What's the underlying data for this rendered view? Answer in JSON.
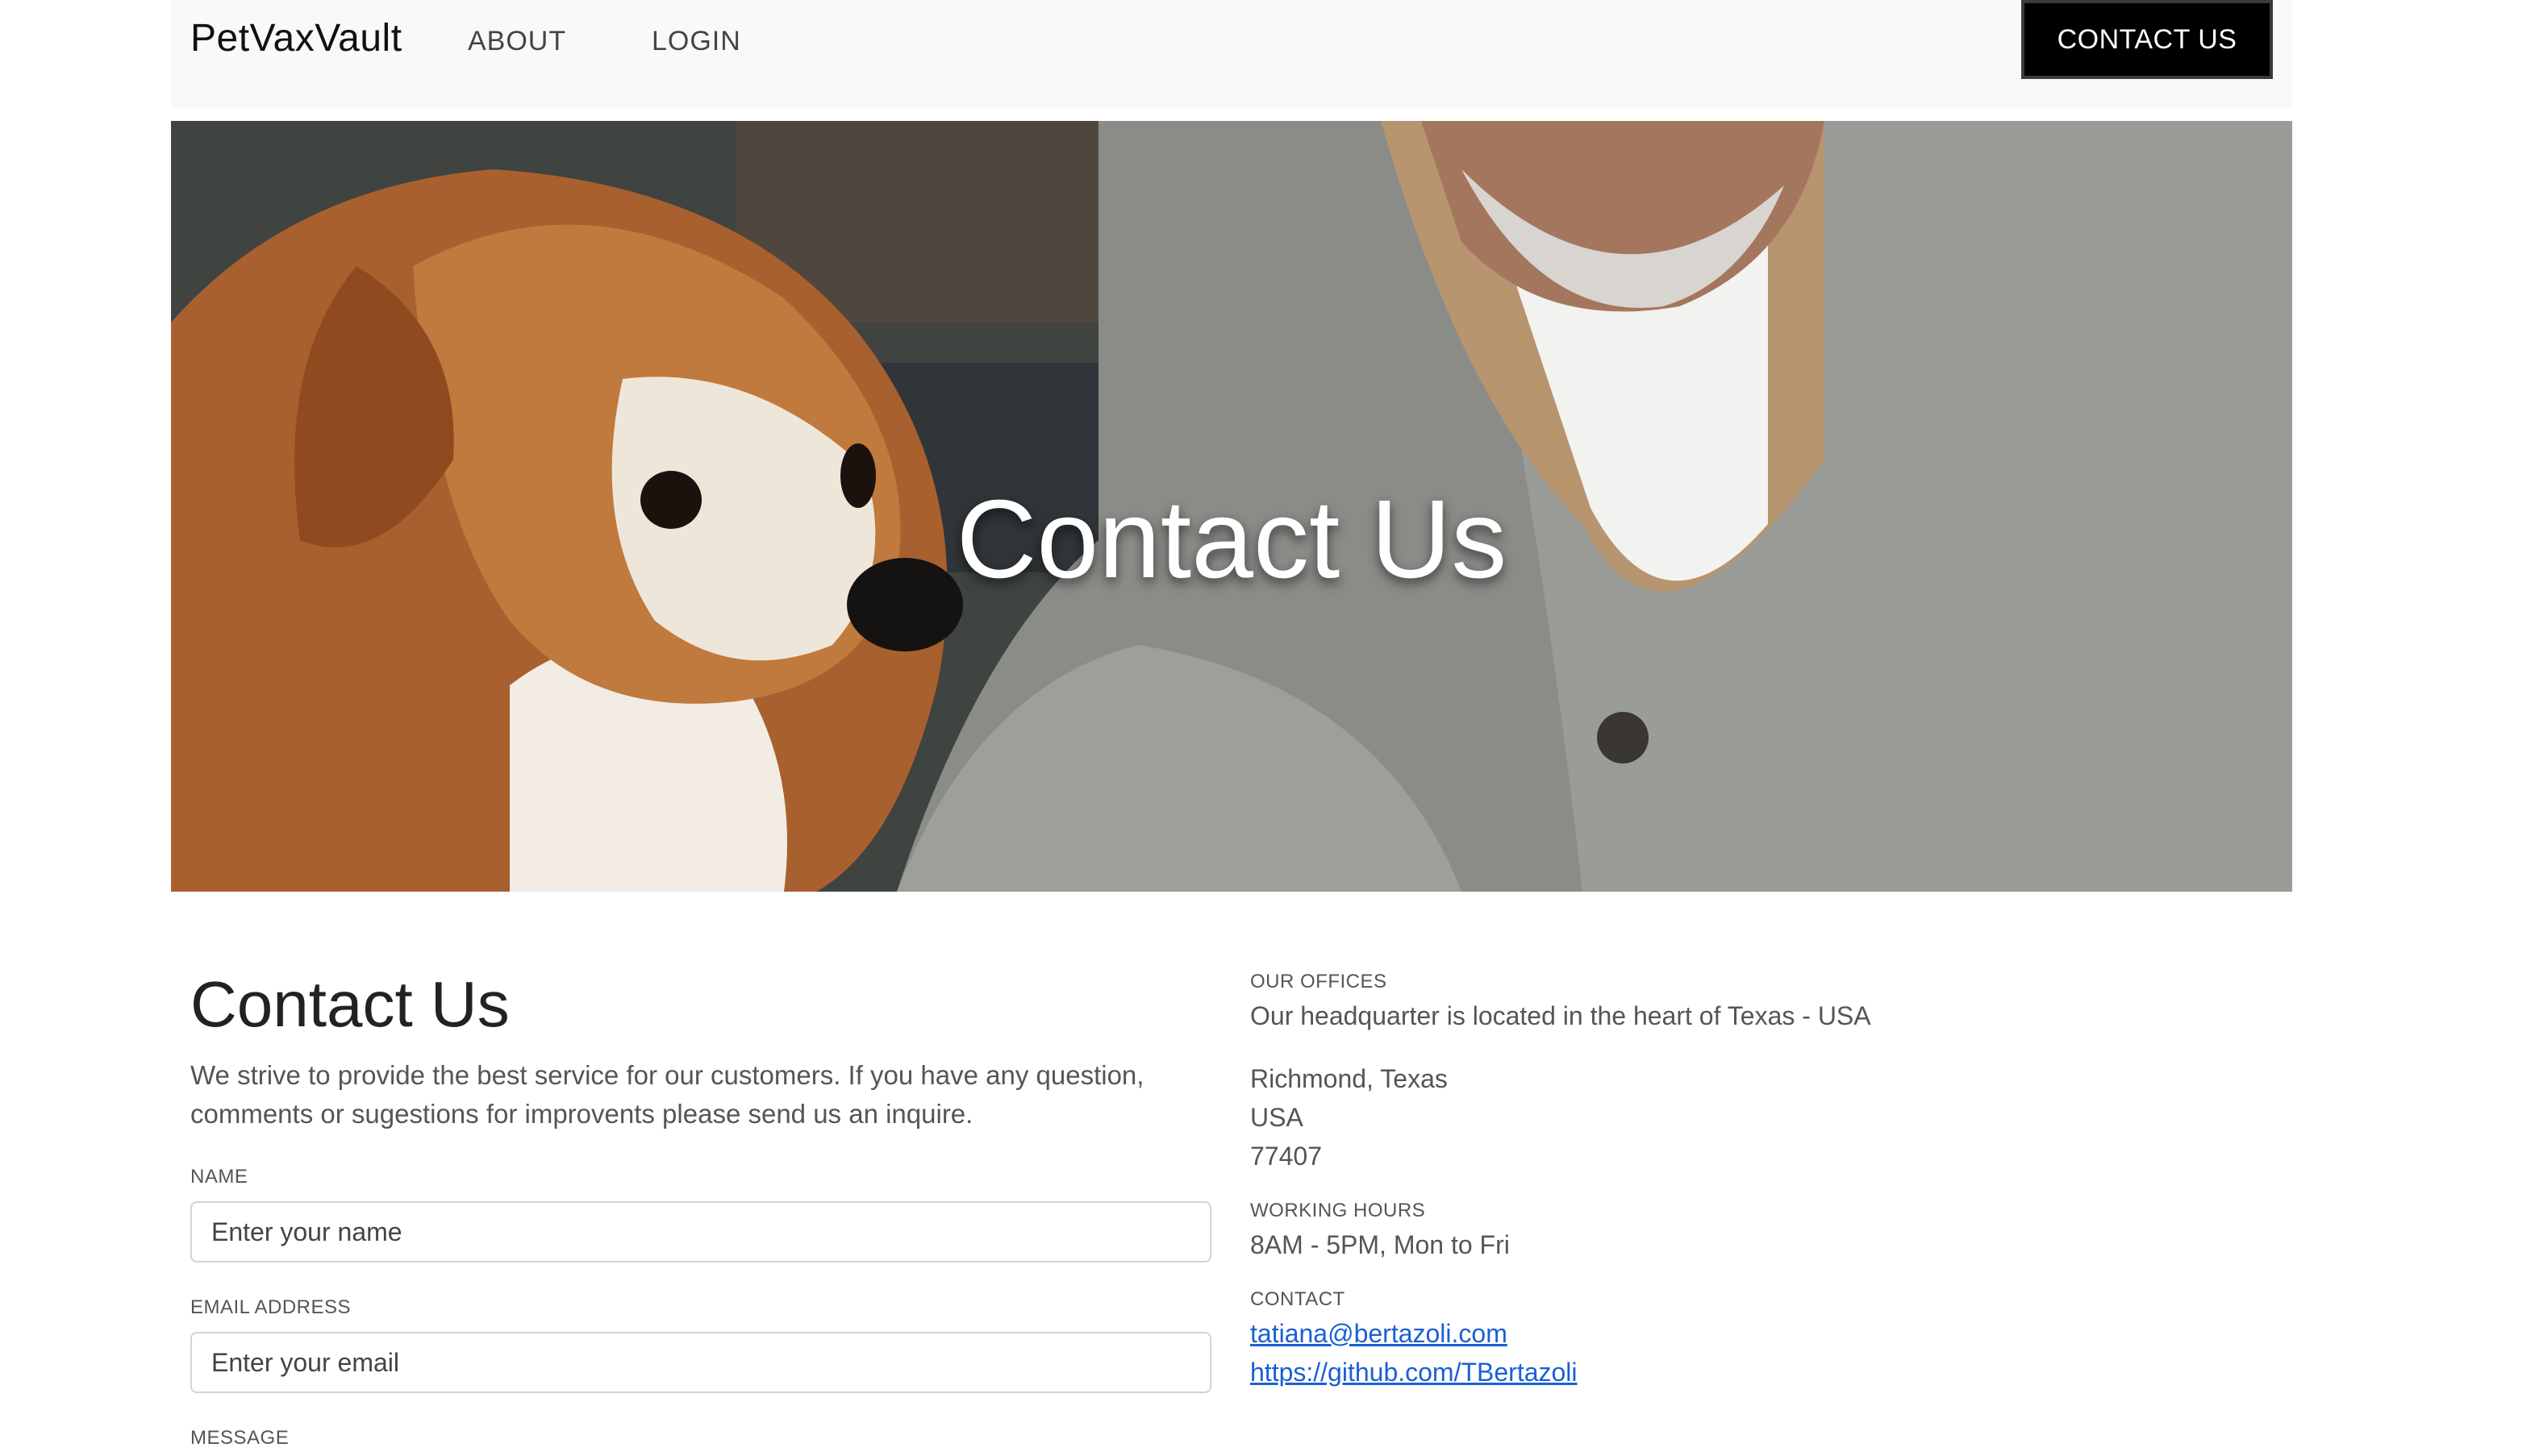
{
  "navbar": {
    "brand": "PetVaxVault",
    "links": [
      {
        "label": "ABOUT"
      },
      {
        "label": "LOGIN"
      }
    ],
    "cta": "CONTACT US"
  },
  "hero": {
    "title": "Contact Us"
  },
  "main": {
    "title": "Contact Us",
    "intro": "We strive to provide the best service for our customers. If you have any question, comments or sugestions for improvents please send us an inquire.",
    "form": {
      "name_label": "NAME",
      "name_placeholder": "Enter your name",
      "email_label": "EMAIL ADDRESS",
      "email_placeholder": "Enter your email",
      "message_label": "MESSAGE"
    }
  },
  "info": {
    "offices_label": "OUR OFFICES",
    "offices_text": "Our headquarter is located in the heart of Texas - USA",
    "address": [
      "Richmond, Texas",
      "USA",
      "77407"
    ],
    "hours_label": "WORKING HOURS",
    "hours_text": "8AM - 5PM, Mon to Fri",
    "contact_label": "CONTACT",
    "email": "tatiana@bertazoli.com",
    "github": "https://github.com/TBertazoli"
  }
}
